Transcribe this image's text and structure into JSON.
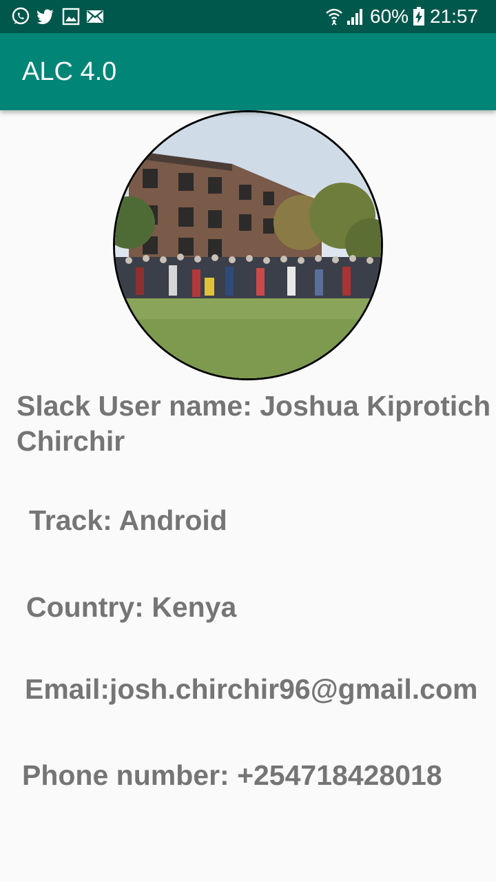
{
  "status_bar": {
    "left_icons": [
      "whatsapp-icon",
      "twitter-icon",
      "gallery-icon",
      "email-icon"
    ],
    "battery": "60%",
    "time": "21:57",
    "background": "#00574b"
  },
  "app_bar": {
    "title": "ALC 4.0",
    "background": "#008577"
  },
  "profile": {
    "photo": "group-photo",
    "slack_user_name": "Slack User name: Joshua Kiprotich Chirchir",
    "track": "Track: Android",
    "country": "Country: Kenya",
    "email": "Email:josh.chirchir96@gmail.com",
    "phone": "Phone number: +254718428018"
  },
  "colors": {
    "text": "#757575",
    "background": "#fafafa"
  }
}
